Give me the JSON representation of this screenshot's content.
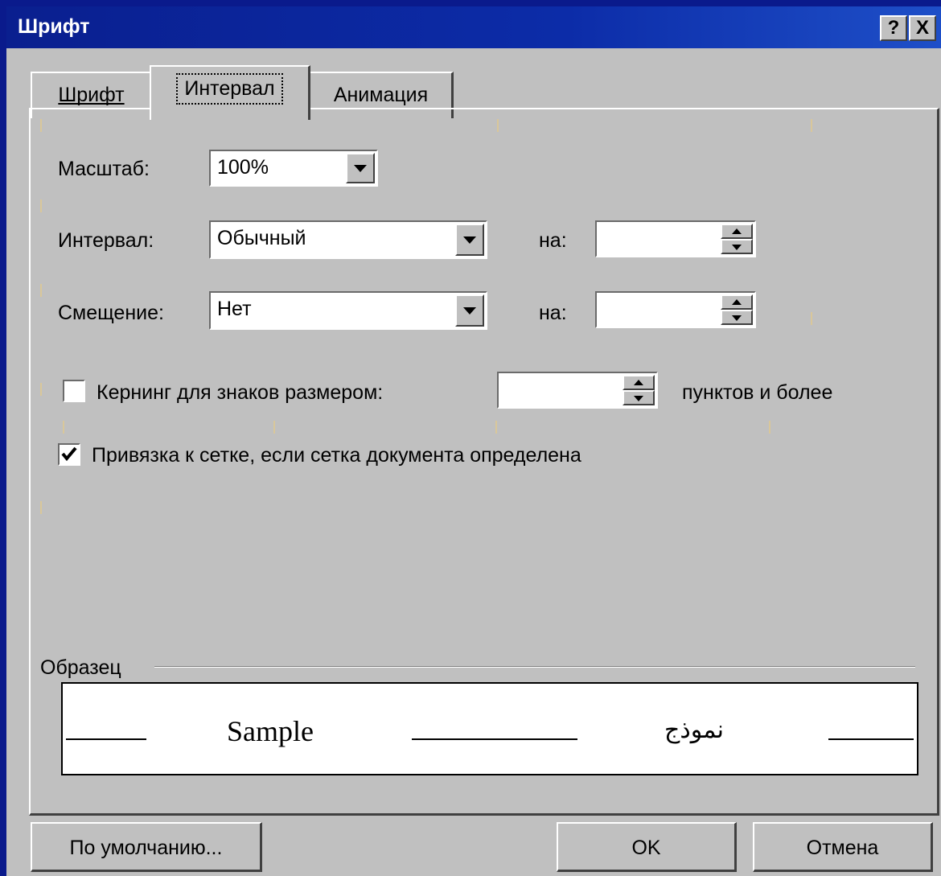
{
  "window": {
    "title": "Шрифт",
    "help_label": "?",
    "close_label": "X"
  },
  "tabs": [
    {
      "label": "Шрифт",
      "active": false
    },
    {
      "label": "Интервал",
      "active": true
    },
    {
      "label": "Анимация",
      "active": false
    }
  ],
  "scale": {
    "label": "Масштаб:",
    "value": "100%"
  },
  "spacing": {
    "label": "Интервал:",
    "value": "Обычный",
    "by_label": "на:",
    "by_value": ""
  },
  "position": {
    "label": "Смещение:",
    "value": "Нет",
    "by_label": "на:",
    "by_value": ""
  },
  "kerning": {
    "label": "Кернинг для знаков размером:",
    "value": "",
    "suffix": "пунктов и более",
    "checked": false
  },
  "grid_snap": {
    "label": "Привязка к сетке, если сетка документа определена",
    "checked": true
  },
  "preview": {
    "label": "Образец",
    "sample_latin": "Sample",
    "sample_arabic": "نموذج"
  },
  "buttons": {
    "default": "По умолчанию...",
    "ok": "OK",
    "cancel": "Отмена"
  }
}
